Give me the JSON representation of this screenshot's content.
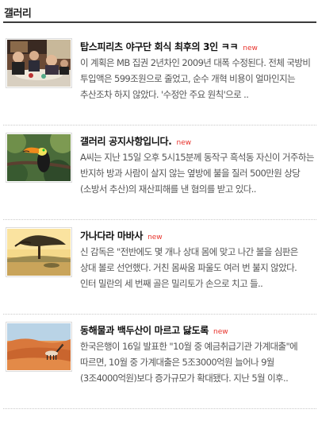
{
  "header": {
    "title": "갤러리"
  },
  "items": [
    {
      "title": "탑스피리츠 야구단 회식 최후의 3인 ㅋㅋ",
      "badge": "new",
      "desc": "이 계획은 MB 집권 2년차인 2009년 대폭 수정된다. 전체 국방비 투입액은 599조원으로 줄었고, 순수 개혁 비용이 얼마인지는 추산조차 하지 않았다. '수정안 주요 원칙'으로 ..",
      "thumb_icon": "restaurant-photo"
    },
    {
      "title": "갤러리 공지사항입니다.",
      "badge": "new",
      "desc": "A씨는 지난 15일 오후 5시15분께 동작구 흑석동 자신이 거주하는 반지하 방과 사람이 살지 않는 옆방에 불을 질러 500만원 상당(소방서 추산)의 재산피해를 낸 혐의를 받고 있다..",
      "thumb_icon": "toucan-photo"
    },
    {
      "title": "가나다라 마바사",
      "badge": "new",
      "desc": "신 감독은 \"전반에도 몇 개나 상대 몸에 맞고 나간 볼을 심판은 상대 볼로 선언했다. 거친 몸싸움 파울도 여러 번 불지 않았다. 인터 밀란의 세 번째 골은 밀리토가 손으로 치고 들..",
      "thumb_icon": "tree-landscape-photo"
    },
    {
      "title": "동해물과 백두산이 마르고 닳도록",
      "badge": "new",
      "desc": "한국은행이 16일 발표한 \"10월 중 예금취급기관 가계대출\"에 따르면, 10월 중 가계대출은 5조3000억원 늘어나 9월(3조4000억원)보다 증가규모가 확대됐다. 지난 5월 이후..",
      "thumb_icon": "desert-oryx-photo"
    }
  ]
}
